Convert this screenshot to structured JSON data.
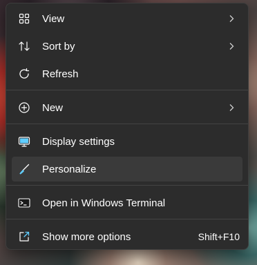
{
  "menu": {
    "items": [
      {
        "label": "View",
        "icon": "grid-icon",
        "has_submenu": true
      },
      {
        "label": "Sort by",
        "icon": "sort-arrows-icon",
        "has_submenu": true
      },
      {
        "label": "Refresh",
        "icon": "refresh-icon",
        "has_submenu": false
      },
      {
        "label": "New",
        "icon": "plus-circle-icon",
        "has_submenu": true
      },
      {
        "label": "Display settings",
        "icon": "monitor-icon",
        "has_submenu": false
      },
      {
        "label": "Personalize",
        "icon": "brush-icon",
        "has_submenu": false,
        "highlighted": true
      },
      {
        "label": "Open in Windows Terminal",
        "icon": "terminal-icon",
        "has_submenu": false
      },
      {
        "label": "Show more options",
        "icon": "external-icon",
        "has_submenu": false,
        "shortcut": "Shift+F10"
      }
    ]
  },
  "colors": {
    "menu_bg": "#2c2c2c",
    "hover_bg": "#3a3a3a",
    "text": "#ffffff",
    "accent": "#60cdff"
  }
}
